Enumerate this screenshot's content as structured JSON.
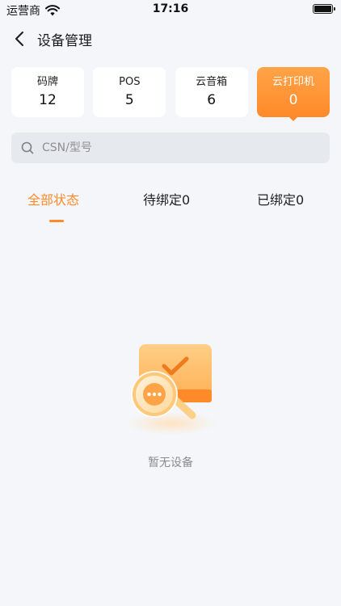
{
  "status_bar": {
    "carrier": "运营商",
    "time": "17:16",
    "battery_level": 1.0
  },
  "nav": {
    "title": "设备管理",
    "back_icon": "chevron-left-icon"
  },
  "categories": [
    {
      "label": "码牌",
      "count": "12",
      "active": false
    },
    {
      "label": "POS",
      "count": "5",
      "active": false
    },
    {
      "label": "云音箱",
      "count": "6",
      "active": false
    },
    {
      "label": "云打印机",
      "count": "0",
      "active": true
    }
  ],
  "search": {
    "placeholder": "CSN/型号",
    "value": "",
    "icon": "search-icon"
  },
  "tabs": [
    {
      "label": "全部状态",
      "active": true
    },
    {
      "label": "待绑定0",
      "active": false
    },
    {
      "label": "已绑定0",
      "active": false
    }
  ],
  "empty_state": {
    "message": "暂无设备",
    "icon": "empty-search-illustration"
  },
  "colors": {
    "accent": "#ff8a2a",
    "background": "#f4f6fa",
    "card": "#ffffff"
  }
}
